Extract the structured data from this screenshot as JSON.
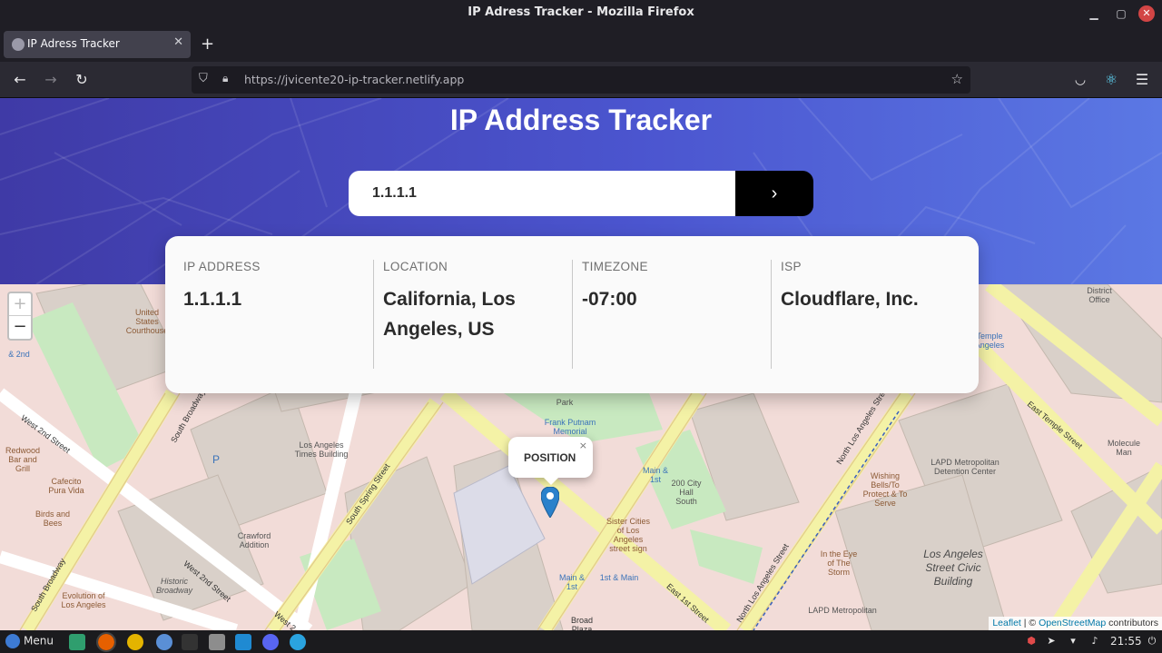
{
  "window": {
    "title": "IP Adress Tracker - Mozilla Firefox"
  },
  "tab": {
    "title": "IP Adress Tracker"
  },
  "urlbar": {
    "url": "https://jvicente20-ip-tracker.netlify.app"
  },
  "page": {
    "title": "IP Address Tracker",
    "search": {
      "value": "1.1.1.1",
      "submit_icon": "chevron-right-icon"
    },
    "info": {
      "ip_label": "IP ADDRESS",
      "ip_value": "1.1.1.1",
      "location_label": "LOCATION",
      "location_value": "California, Los Angeles, US",
      "timezone_label": "TIMEZONE",
      "timezone_value": "-07:00",
      "isp_label": "ISP",
      "isp_value": "Cloudflare, Inc."
    }
  },
  "map": {
    "zoom_in": "+",
    "zoom_out": "−",
    "popup_text": "POSITION",
    "popup_close": "×",
    "attribution": {
      "leaflet": "Leaflet",
      "sep": "| ©",
      "osm": "OpenStreetMap",
      "contributors": "contributors"
    },
    "labels": {
      "us_courthouse": "United States Courthouse",
      "district_office": "District Office",
      "second_and_second": "& 2nd",
      "west_2nd_street": "West 2nd Street",
      "south_broadway": "South Broadway",
      "redwood": "Redwood Bar and Grill",
      "cafecito": "Cafecito Pura Vida",
      "birds": "Birds and Bees",
      "la_times": "Los Angeles Times Building",
      "crawford": "Crawford Addition",
      "historic_broadway": "Historic Broadway",
      "evolution": "Evolution of Los Angeles",
      "south_spring": "South Spring Street",
      "park": "Park",
      "frank_putnam": "Frank Putnam Memorial",
      "main_1st": "Main & 1st",
      "city_hall_south": "200 City Hall South",
      "sister_cities": "Sister Cities of Los Angeles street sign",
      "main_1st_2": "Main & 1st",
      "first_main": "1st & Main",
      "broad_plaza": "Broad Plaza",
      "east_1st_street": "East 1st Street",
      "north_la_street": "North Los Angeles Street",
      "wishing_bells": "Wishing Bells/To Protect & To Serve",
      "lapd_detention": "LAPD Metropolitan Detention Center",
      "eye_of_storm": "In the Eye of The Storm",
      "la_civic": "Los Angeles Street Civic Building",
      "lapd_metro": "LAPD Metropolitan",
      "east_temple": "East Temple Street",
      "molecule": "Molecule Man",
      "temple_angeles": "Temple Angeles",
      "west_2": "West 2",
      "p_marker": "P"
    }
  },
  "taskbar": {
    "menu": "Menu",
    "clock": "21:55"
  }
}
